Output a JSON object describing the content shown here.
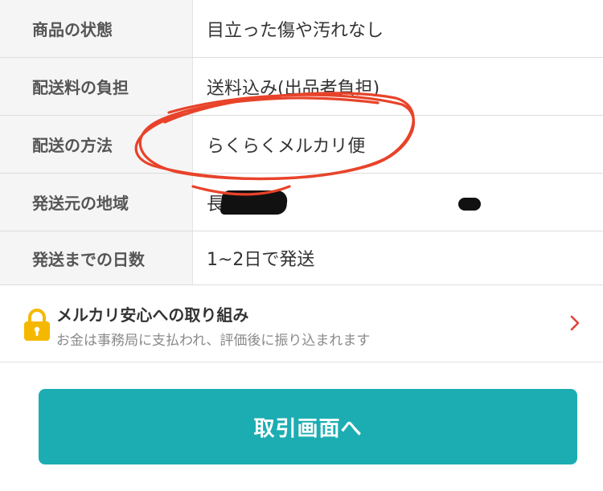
{
  "details": {
    "rows": [
      {
        "label": "商品の状態",
        "value": "目立った傷や汚れなし"
      },
      {
        "label": "配送料の負担",
        "value": "送料込み(出品者負担)"
      },
      {
        "label": "配送の方法",
        "value": "らくらくメルカリ便"
      },
      {
        "label": "発送元の地域",
        "value": "長"
      },
      {
        "label": "発送までの日数",
        "value": "1~2日で発送"
      }
    ]
  },
  "safety": {
    "title": "メルカリ安心への取り組み",
    "description": "お金は事務局に支払われ、評価後に振り込まれます",
    "icon": "lock-icon",
    "icon_color": "#f5b800"
  },
  "action": {
    "button_label": "取引画面へ",
    "button_color": "#1cadb3"
  },
  "annotation": {
    "scribble_color": "#e8432a"
  }
}
